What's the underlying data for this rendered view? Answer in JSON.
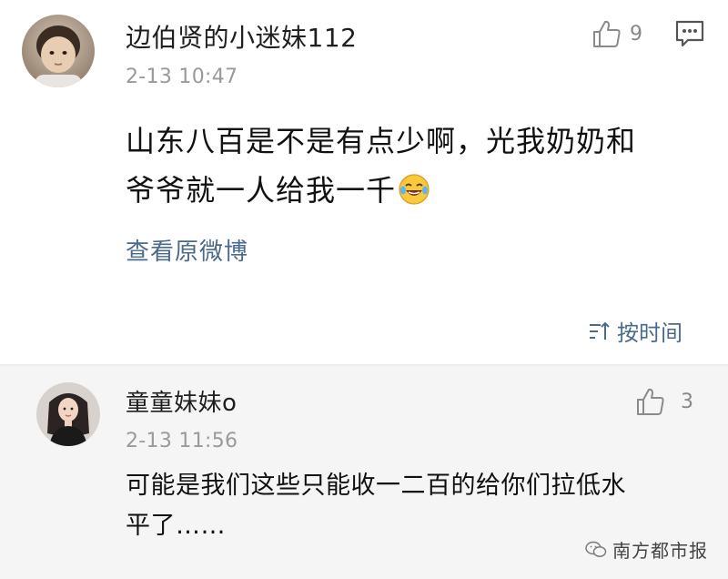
{
  "main_comment": {
    "username": "边伯贤的小迷妹112",
    "timestamp": "2-13 10:47",
    "text_line1": "山东八百是不是有点少啊，光我奶奶和",
    "text_line2": "爷爷就一人给我一千",
    "emoji": "laughing-tears-emoji",
    "like_count": "9",
    "view_original_link": "查看原微博"
  },
  "sort": {
    "label": "按时间"
  },
  "reply": {
    "username": "童童妹妹o",
    "timestamp": "2-13 11:56",
    "text_line1": "可能是我们这些只能收一二百的给你们拉低水",
    "text_line2": "平了……",
    "like_count": "3"
  },
  "watermark": {
    "label": "南方都市报"
  },
  "colors": {
    "link": "#4a6b8d",
    "reply_background": "#f5f5f5",
    "timestamp": "#9a9a9a"
  }
}
